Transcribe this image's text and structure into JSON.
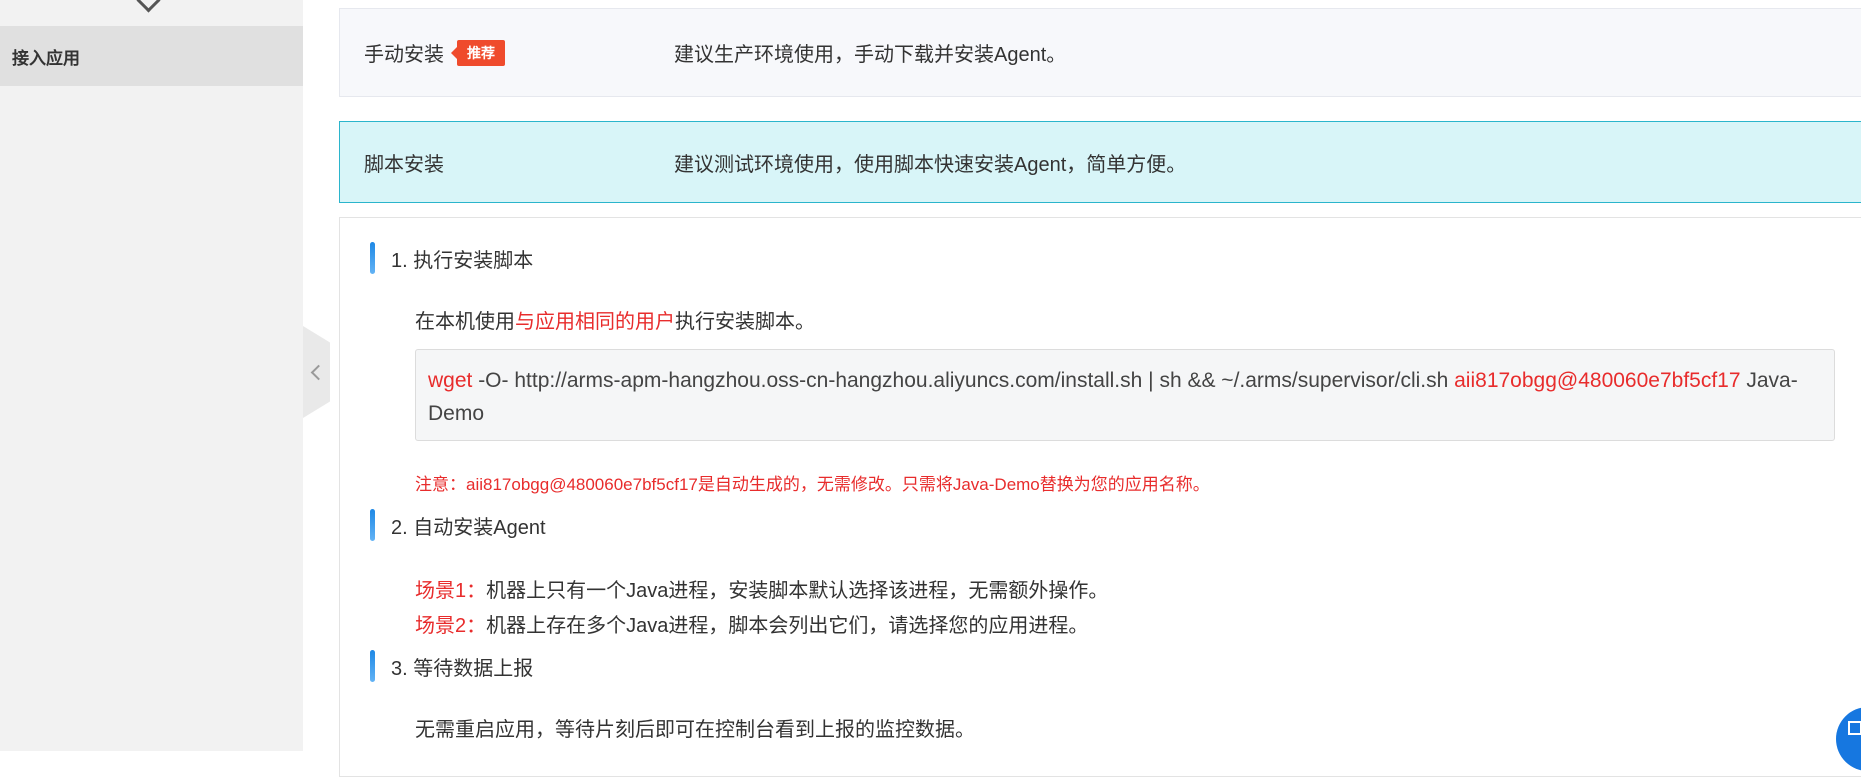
{
  "sidebar": {
    "active_item": "接入应用"
  },
  "options": {
    "manual": {
      "title": "手动安装",
      "badge": "推荐",
      "desc": "建议生产环境使用，手动下载并安装Agent。"
    },
    "script": {
      "title": "脚本安装",
      "desc": "建议测试环境使用，使用脚本快速安装Agent，简单方便。"
    }
  },
  "steps": {
    "step1": {
      "title": "1. 执行安装脚本",
      "text_prefix": "在本机使用",
      "text_highlight": "与应用相同的用户",
      "text_suffix": "执行安装脚本。",
      "code": {
        "cmd": "wget",
        "middle": " -O- http://arms-apm-hangzhou.oss-cn-hangzhou.aliyuncs.com/install.sh | sh && ~/.arms/supervisor/cli.sh ",
        "token": "aii817obgg@480060e7bf5cf17",
        "app": " Java-Demo"
      },
      "note": "注意：aii817obgg@480060e7bf5cf17是自动生成的，无需修改。只需将Java-Demo替换为您的应用名称。"
    },
    "step2": {
      "title": "2. 自动安装Agent",
      "scenario1_label": "场景1：",
      "scenario1_text": "机器上只有一个Java进程，安装脚本默认选择该进程，无需额外操作。",
      "scenario2_label": "场景2：",
      "scenario2_text": "机器上存在多个Java进程，脚本会列出它们，请选择您的应用进程。"
    },
    "step3": {
      "title": "3. 等待数据上报",
      "text": "无需重启应用，等待片刻后即可在控制台看到上报的监控数据。"
    }
  },
  "icons": {
    "sidebar_top": "chevron-icon",
    "collapse": "chevron-left-icon",
    "float": "apps-icon"
  }
}
